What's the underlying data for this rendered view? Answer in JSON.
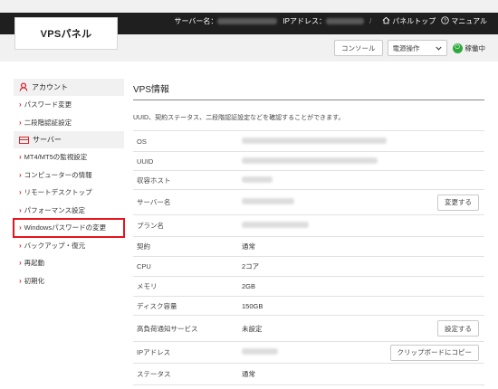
{
  "header": {
    "logo": "VPSパネル",
    "server_name_label": "サーバー名：",
    "ip_label": "IPアドレス：",
    "separator": "/",
    "panel_top": "パネルトップ",
    "manual": "マニュアル",
    "console_button": "コンソール",
    "power_select": "電源操作",
    "status": "稼働中"
  },
  "sidebar": {
    "account_heading": "アカウント",
    "account_items": [
      "パスワード変更",
      "二段階認証設定"
    ],
    "server_heading": "サーバー",
    "server_items": [
      "MT4/MT5の監視設定",
      "コンピューターの情報",
      "リモートデスクトップ",
      "パフォーマンス設定",
      "Windowsパスワードの変更",
      "バックアップ・復元",
      "再起動",
      "初期化"
    ]
  },
  "main": {
    "title": "VPS情報",
    "description": "UUID、契約ステータス、二段階認証設定などを確認することができます。",
    "rows": [
      {
        "label": "OS",
        "value": ""
      },
      {
        "label": "UUID",
        "value": ""
      },
      {
        "label": "収容ホスト",
        "value": ""
      },
      {
        "label": "サーバー名",
        "value": "",
        "action": "変更する"
      },
      {
        "label": "プラン名",
        "value": ""
      },
      {
        "label": "契約",
        "value": "通常"
      },
      {
        "label": "CPU",
        "value": "2コア"
      },
      {
        "label": "メモリ",
        "value": "2GB"
      },
      {
        "label": "ディスク容量",
        "value": "150GB"
      },
      {
        "label": "高負荷通知サービス",
        "value": "未設定",
        "action": "設定する"
      },
      {
        "label": "IPアドレス",
        "value": "",
        "action": "クリップボードにコピー"
      },
      {
        "label": "ステータス",
        "value": "通常"
      }
    ]
  },
  "colors": {
    "accent": "#d9232d",
    "status_green": "#2eaa3c",
    "header_dark": "#1f1f1f"
  }
}
